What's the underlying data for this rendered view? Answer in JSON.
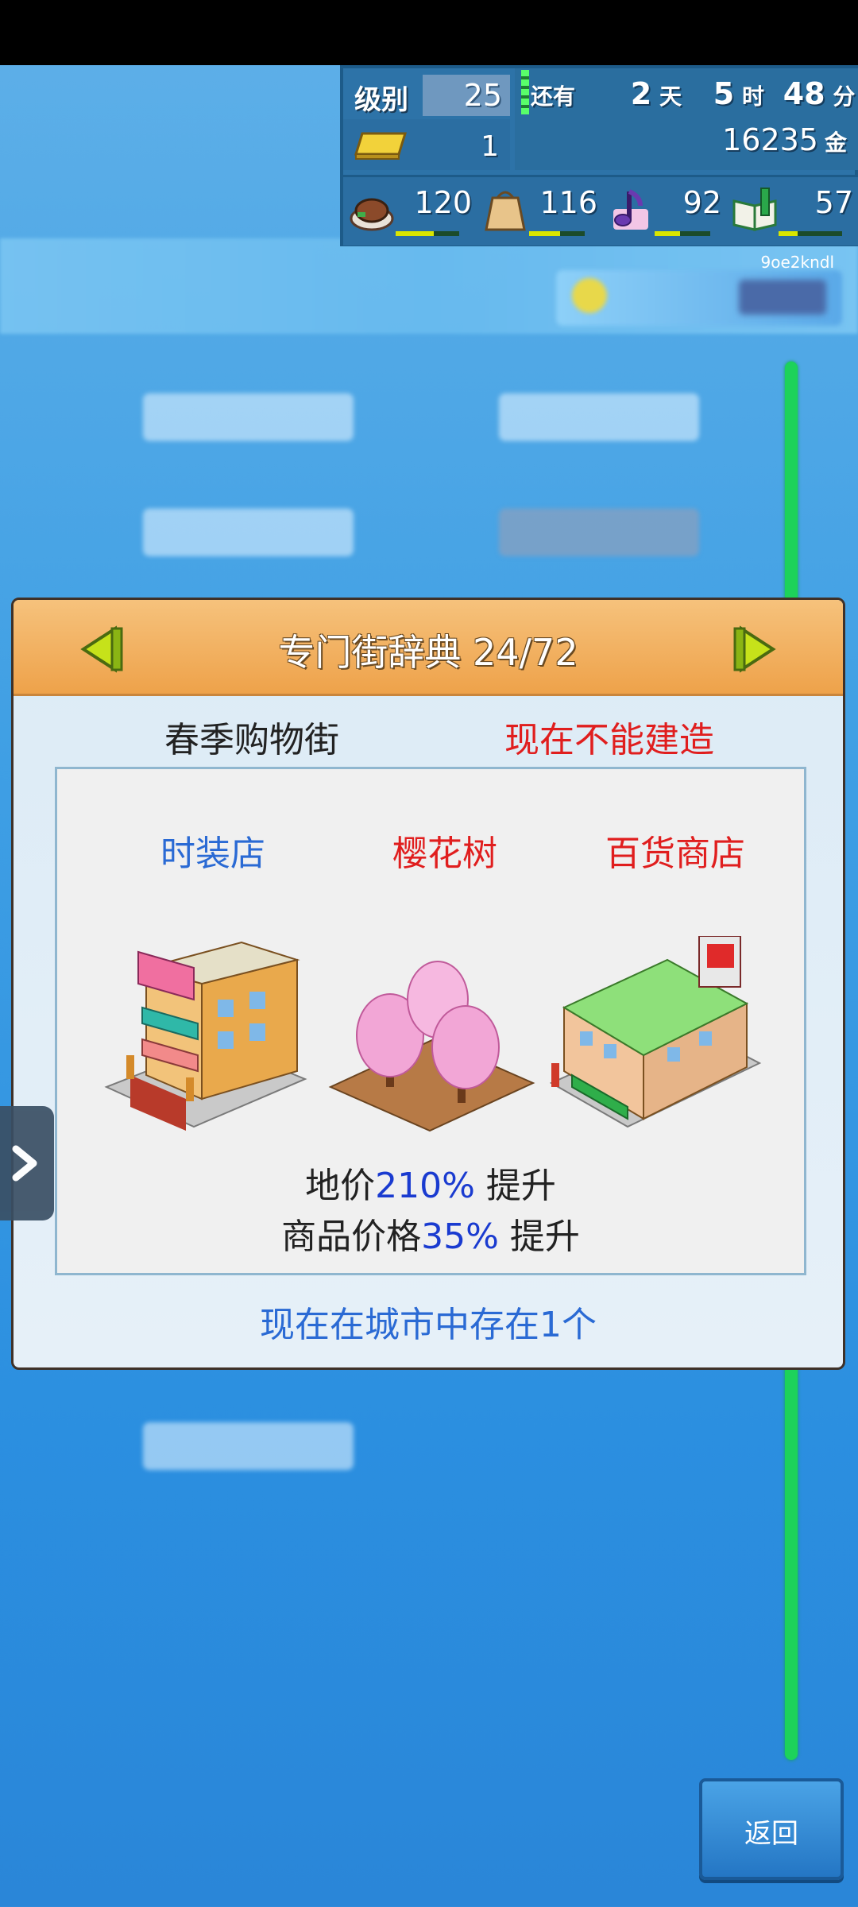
{
  "hud": {
    "level_label": "级别",
    "level_value": "25",
    "time_prefix": "还有",
    "days_value": "2",
    "days_unit": "天",
    "hours_value": "5",
    "hours_unit": "时",
    "minutes_value": "48",
    "minutes_unit": "分",
    "gold_bars": "1",
    "money": "16235",
    "money_unit": "金",
    "stats": [
      {
        "icon": "food-icon",
        "value": "120",
        "gauge": 0.6
      },
      {
        "icon": "bag-icon",
        "value": "116",
        "gauge": 0.55
      },
      {
        "icon": "music-note-icon",
        "value": "92",
        "gauge": 0.45
      },
      {
        "icon": "book-icon",
        "value": "57",
        "gauge": 0.3
      }
    ]
  },
  "watermark_id": "9oe2kndl",
  "panel": {
    "title": "专门街辞典 24/72",
    "street_name": "春季购物街",
    "build_status": "现在不能建造",
    "buildings": [
      {
        "name": "时装店",
        "color": "#2a6ad4"
      },
      {
        "name": "樱花树",
        "color": "#e01e1e"
      },
      {
        "name": "百货商店",
        "color": "#e01e1e"
      }
    ],
    "effect1_label": "地价",
    "effect1_pct": "210%",
    "effect1_suffix": " 提升",
    "effect2_label": "商品价格",
    "effect2_pct": "35%",
    "effect2_suffix": " 提升",
    "existing_text": "现在在城市中存在1个"
  },
  "back_button": "返回"
}
